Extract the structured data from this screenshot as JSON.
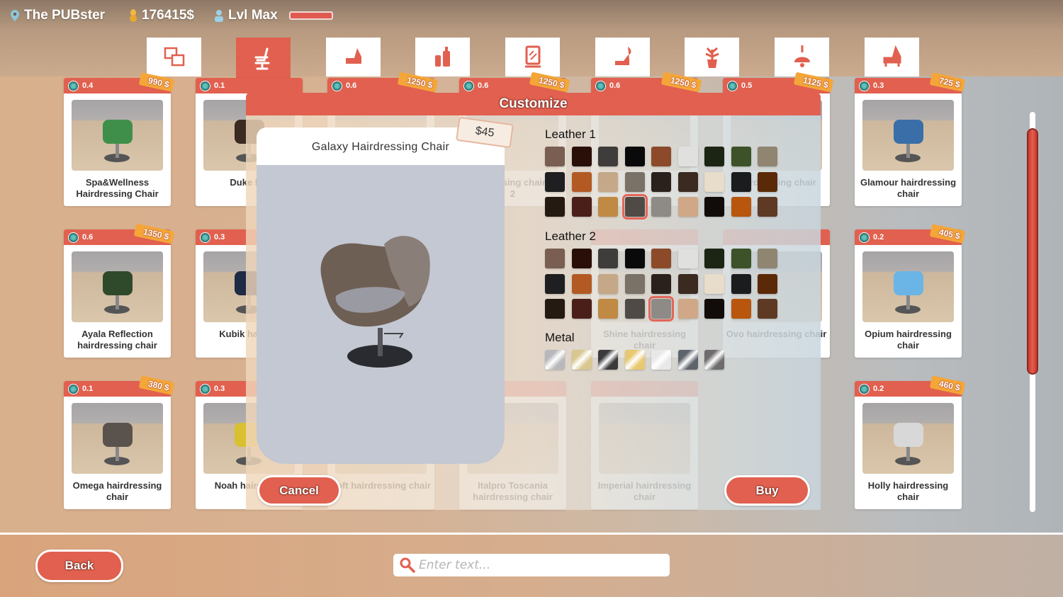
{
  "hud": {
    "location": "The PUBster",
    "money": "176415$",
    "level": "Lvl Max",
    "level_progress": 1.0
  },
  "tabs": [
    {
      "icon": "rooms-icon",
      "active": false
    },
    {
      "icon": "hairdressing-chair-icon",
      "active": true
    },
    {
      "icon": "sofa-chair-icon",
      "active": false
    },
    {
      "icon": "cosmetics-bottles-icon",
      "active": false
    },
    {
      "icon": "mirror-icon",
      "active": false
    },
    {
      "icon": "wash-chair-icon",
      "active": false
    },
    {
      "icon": "plant-icon",
      "active": false
    },
    {
      "icon": "lamp-icon",
      "active": false
    },
    {
      "icon": "chair-icon",
      "active": false
    }
  ],
  "cards": [
    {
      "row": 0,
      "col": 0,
      "rating": "0.4",
      "price": "990 $",
      "name": "Spa&Wellness Hairdressing Chair",
      "color": "#3f8f4a"
    },
    {
      "row": 0,
      "col": 1,
      "rating": "0.1",
      "price": "",
      "name": "Duke hai",
      "color": "#3a2a22"
    },
    {
      "row": 0,
      "col": 2,
      "rating": "0.6",
      "price": "1250 $",
      "name": "",
      "color": ""
    },
    {
      "row": 0,
      "col": 3,
      "rating": "0.6",
      "price": "1250 $",
      "name": "hairdressing chair no 2",
      "color": ""
    },
    {
      "row": 0,
      "col": 4,
      "rating": "0.6",
      "price": "1250 $",
      "name": "",
      "color": ""
    },
    {
      "row": 0,
      "col": 5,
      "rating": "0.5",
      "price": "1125 $",
      "name": "hairdressing chair",
      "color": ""
    },
    {
      "row": 0,
      "col": 6,
      "rating": "0.3",
      "price": "725 $",
      "name": "Glamour hairdressing chair",
      "color": "#3a6ea8"
    },
    {
      "row": 1,
      "col": 0,
      "rating": "0.6",
      "price": "1350 $",
      "name": "Ayala Reflection hairdressing chair",
      "color": "#2f4a2a"
    },
    {
      "row": 1,
      "col": 1,
      "rating": "0.3",
      "price": "",
      "name": "Kubik ha chai",
      "color": "#1f2a44"
    },
    {
      "row": 1,
      "col": 4,
      "rating": "",
      "price": "",
      "name": "Shine hairdressing chair",
      "color": ""
    },
    {
      "row": 1,
      "col": 5,
      "rating": "",
      "price": "",
      "name": "Ovo hairdressing chair",
      "color": ""
    },
    {
      "row": 1,
      "col": 6,
      "rating": "0.2",
      "price": "405 $",
      "name": "Opium hairdressing chair",
      "color": "#6ab4e6"
    },
    {
      "row": 2,
      "col": 0,
      "rating": "0.1",
      "price": "380 $",
      "name": "Omega hairdressing chair",
      "color": "#5a524c"
    },
    {
      "row": 2,
      "col": 1,
      "rating": "0.3",
      "price": "",
      "name": "Noah haird chai",
      "color": "#d8c030"
    },
    {
      "row": 2,
      "col": 2,
      "rating": "",
      "price": "",
      "name": "Loft hairdressing chair",
      "color": ""
    },
    {
      "row": 2,
      "col": 3,
      "rating": "",
      "price": "",
      "name": "Italpro Toscania hairdressing chair",
      "color": ""
    },
    {
      "row": 2,
      "col": 4,
      "rating": "",
      "price": "",
      "name": "Imperial hairdressing chair",
      "color": ""
    },
    {
      "row": 2,
      "col": 6,
      "rating": "0.2",
      "price": "460 $",
      "name": "Holly hairdressing chair",
      "color": "#d8d8d8"
    }
  ],
  "modal": {
    "title": "Customize",
    "item_name": "Galaxy Hairdressing Chair",
    "price": "$45",
    "sections": [
      {
        "label": "Leather 1",
        "selected": 21,
        "colors": [
          "#7a5e52",
          "#2a0f08",
          "#3f3d3b",
          "#0a0a0a",
          "#8c4a2a",
          "#e0e0de",
          "#1c2414",
          "#3d5228",
          "#8f8570",
          "#1f1f21",
          "#b35a24",
          "#c4a888",
          "#7a7266",
          "#2a211c",
          "#3a2a20",
          "#e8dccb",
          "#1b1c1e",
          "#5a2a08",
          "#241a12",
          "#4a1f1a",
          "#c08a44",
          "#504a46",
          "#8e8a86",
          "#d0a888",
          "#110c0a",
          "#b8560e",
          "#5e3a24"
        ]
      },
      {
        "label": "Leather 2",
        "selected": 22,
        "colors": [
          "#7a5e52",
          "#2a0f08",
          "#3f3d3b",
          "#0a0a0a",
          "#8c4a2a",
          "#e0e0de",
          "#1c2414",
          "#3d5228",
          "#8f8570",
          "#1f1f21",
          "#b35a24",
          "#c4a888",
          "#7a7266",
          "#2a211c",
          "#3a2a20",
          "#e8dccb",
          "#1b1c1e",
          "#5a2a08",
          "#241a12",
          "#4a1f1a",
          "#c08a44",
          "#504a46",
          "#8e8a86",
          "#d0a888",
          "#110c0a",
          "#b8560e",
          "#5e3a24"
        ]
      },
      {
        "label": "Metal",
        "selected": -1,
        "colors": [
          "#b8b8bc",
          "#d8c890",
          "#3a3a3c",
          "#e8c870",
          "#e8e8e8",
          "#5e646c",
          "#6e6c6c"
        ]
      }
    ],
    "cancel_label": "Cancel",
    "buy_label": "Buy"
  },
  "footer": {
    "back_label": "Back",
    "search_placeholder": "Enter text...",
    "search_value": ""
  },
  "scrollbar": {
    "position": 0.05,
    "visible_fraction": 0.6
  },
  "colors": {
    "accent": "#e1604f",
    "price_tag": "#f4a638"
  }
}
